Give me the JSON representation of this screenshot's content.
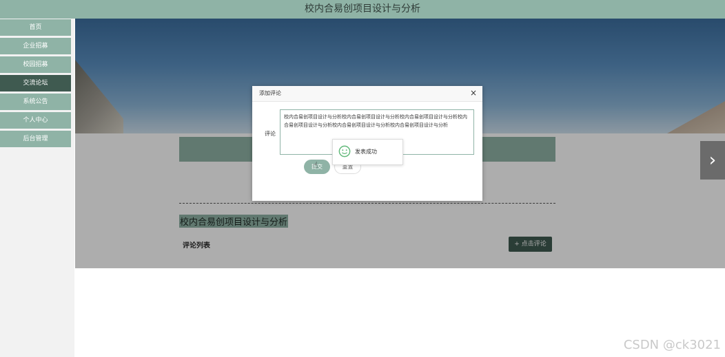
{
  "app": {
    "title": "校内合易创项目设计与分析"
  },
  "sidebar": {
    "items": [
      {
        "label": "首页",
        "active": false
      },
      {
        "label": "企业招募",
        "active": false
      },
      {
        "label": "校园招募",
        "active": false
      },
      {
        "label": "交流论坛",
        "active": true
      },
      {
        "label": "系统公告",
        "active": false
      },
      {
        "label": "个人中心",
        "active": false
      },
      {
        "label": "后台管理",
        "active": false
      }
    ]
  },
  "main": {
    "project_title": "校内合易创项目设计与分析",
    "comment_list_label": "评论列表",
    "comment_button_label": "+ 点击评论",
    "next_icon": "chevron-right-icon"
  },
  "dialog": {
    "title": "添加评论",
    "close_icon": "close-icon",
    "field_label": "评论",
    "textarea_value": "校内合易创项目设计与分析校内合易创项目设计与分析校内合易创项目设计与分析校内合易创项目设计与分析校内合易创项目设计与分析校内合易创项目设计与分析",
    "submit_label": "提交",
    "reset_label": "重置"
  },
  "toast": {
    "message": "发表成功",
    "icon": "smile-icon"
  },
  "watermark": "CSDN @ck3021",
  "colors": {
    "accent": "#8fb3a6",
    "active": "#3f5a50"
  }
}
